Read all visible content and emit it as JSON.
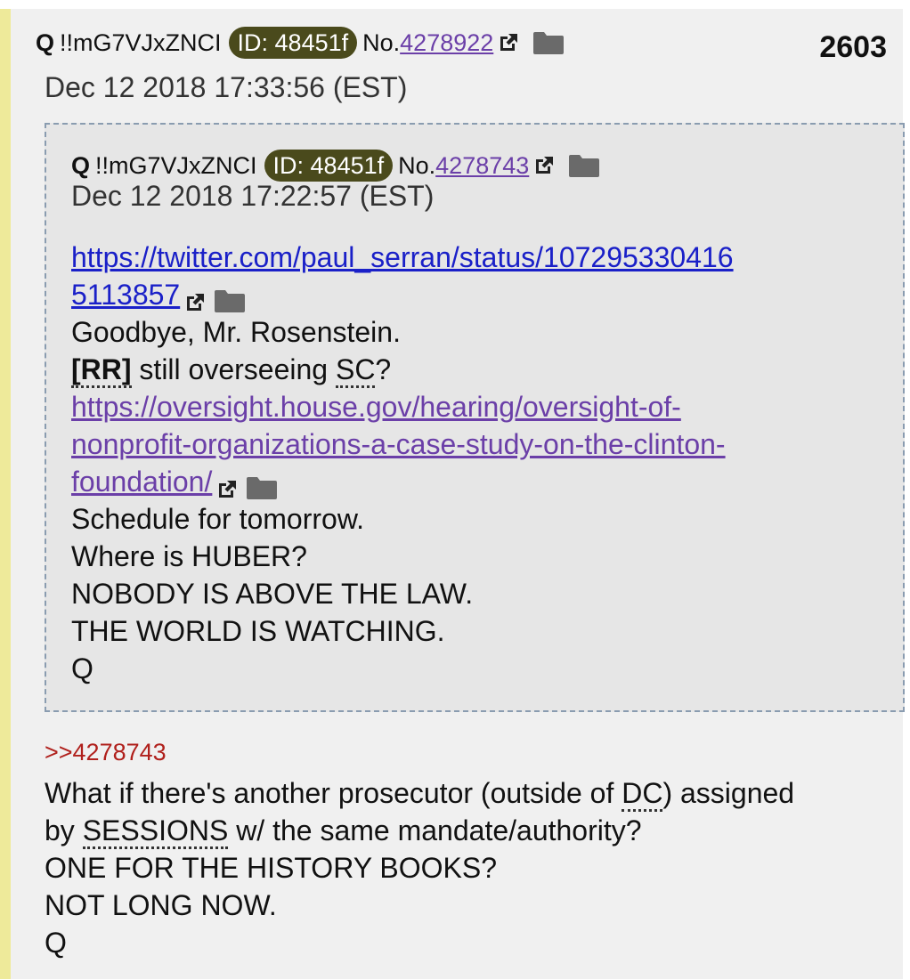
{
  "post": {
    "number": "2603",
    "author": "Q",
    "tripcode": "!!mG7VJxZNCI",
    "id": "ID: 48451f",
    "no_prefix": "No.",
    "post_no": "4278922",
    "date": "Dec 12 2018 17:33:56 (EST)",
    "reply_ref": ">>4278743",
    "body": {
      "l1_a": "What if there's another prosecutor (outside of ",
      "l1_abbr": "DC",
      "l1_b": ") assigned",
      "l2_a": "by ",
      "l2_abbr": "SESSIONS",
      "l2_b": " w/ the same mandate/authority?",
      "l3": "ONE FOR THE HISTORY BOOKS?",
      "l4": "NOT LONG NOW.",
      "l5": "Q"
    }
  },
  "quoted": {
    "author": "Q",
    "tripcode": "!!mG7VJxZNCI",
    "id": "ID: 48451f",
    "no_prefix": "No.",
    "post_no": "4278743",
    "date": "Dec 12 2018 17:22:57 (EST)",
    "link1_part1": "https://twitter.com/paul_serran/status/107295330416",
    "link1_part2": "5113857",
    "line_goodbye": "Goodbye, Mr. Rosenstein.",
    "rr": "[RR]",
    "overseeing": " still overseeing ",
    "sc": "SC",
    "qmark": "?",
    "link2_part1": "https://oversight.house.gov/hearing/oversight-of-",
    "link2_part2": "nonprofit-organizations-a-case-study-on-the-clinton-",
    "link2_part3": "foundation/",
    "line_schedule": "Schedule for tomorrow.",
    "line_huber": "Where is HUBER?",
    "line_nobody": "NOBODY IS ABOVE THE LAW.",
    "line_world": "THE WORLD IS WATCHING.",
    "line_q": "Q"
  },
  "icons": {
    "external": "external-link-icon",
    "folder": "folder-icon"
  },
  "colors": {
    "id_badge": "#4a4a1c",
    "link_visited": "#6b3fa8",
    "link": "#1a20c8",
    "reply_ref": "#b0201c",
    "accent_bar": "#eeea9a"
  }
}
